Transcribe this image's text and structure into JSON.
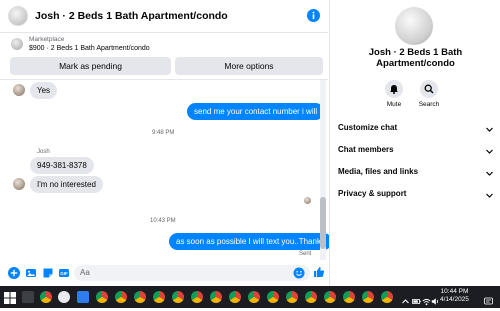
{
  "header": {
    "title": "Josh · 2 Beds 1 Bath Apartment/condo"
  },
  "listing": {
    "label": "Marketplace",
    "price_title": "$900 · 2 Beds 1 Bath Apartment/condo",
    "btn_pending": "Mark as pending",
    "btn_more": "More options"
  },
  "thread": {
    "msg_yes": "Yes",
    "msg_send_number": "send  me your contact number i will",
    "time_1": "9:48 PM",
    "sender_name": "Josh",
    "msg_phone": "949-381-8378",
    "msg_not_interested": "I'm no interested",
    "time_2": "10:43 PM",
    "msg_text_you": "as soon as possible I will text you..Thanks",
    "status_sent": "Sent"
  },
  "composer": {
    "placeholder": "Aa"
  },
  "panel": {
    "name": "Josh · 2 Beds 1 Bath Apartment/condo",
    "mute_label": "Mute",
    "search_label": "Search",
    "sections": [
      "Customize chat",
      "Chat members",
      "Media, files and links",
      "Privacy & support"
    ]
  },
  "taskbar": {
    "time": "10:44 PM",
    "date": "4/14/2025"
  },
  "colors": {
    "accent": "#0084ff",
    "bubble_in": "#e4e6eb",
    "taskbar": "#1b1d23"
  }
}
